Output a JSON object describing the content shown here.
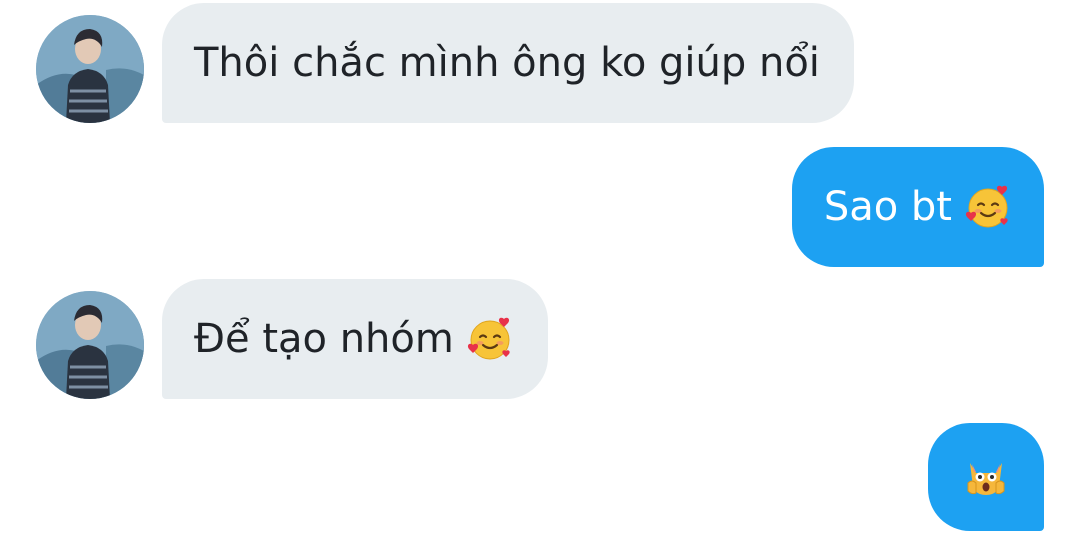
{
  "conversation": {
    "messages": [
      {
        "sender": "other",
        "text": "Thôi chắc mình ông ko giúp nổi",
        "emoji": ""
      },
      {
        "sender": "me",
        "text": "Sao bt",
        "emoji": "smiling-face-with-hearts"
      },
      {
        "sender": "other",
        "text": "Để tạo nhóm",
        "emoji": "smiling-face-with-hearts"
      },
      {
        "sender": "me",
        "text": "",
        "emoji": "weary-cat"
      }
    ]
  },
  "colors": {
    "incoming_bubble": "#e8edf0",
    "incoming_text": "#1f2328",
    "outgoing_bubble": "#1da1f2",
    "outgoing_text": "#ffffff"
  }
}
